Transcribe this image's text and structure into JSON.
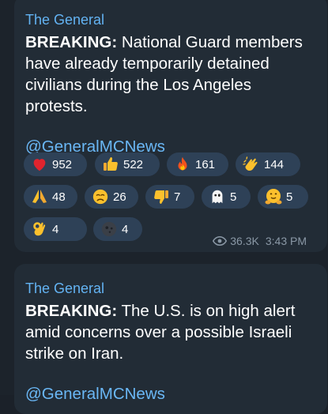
{
  "messages": [
    {
      "sender": "The General",
      "text_bold": "BREAKING:",
      "text_rest": " National Guard members have already temporarily detained civilians during the Los Angeles protests.",
      "link": "@GeneralMCNews",
      "reactions": [
        {
          "icon": "heart-icon",
          "count": "952"
        },
        {
          "icon": "thumbs-up-icon",
          "count": "522"
        },
        {
          "icon": "fire-icon",
          "count": "161"
        },
        {
          "icon": "clapping-hands-icon",
          "count": "144"
        },
        {
          "icon": "praying-hands-icon",
          "count": "48"
        },
        {
          "icon": "sad-face-icon",
          "count": "26"
        },
        {
          "icon": "thumbs-down-icon",
          "count": "7"
        },
        {
          "icon": "ghost-icon",
          "count": "5"
        },
        {
          "icon": "hugging-face-icon",
          "count": "5"
        },
        {
          "icon": "ok-hand-icon",
          "count": "4"
        },
        {
          "icon": "new-moon-face-icon",
          "count": "4"
        }
      ],
      "views": "36.3K",
      "time": "3:43 PM"
    },
    {
      "sender": "The General",
      "text_bold": "BREAKING:",
      "text_rest": " The U.S. is on high alert amid concerns over a possible Israeli strike on Iran.",
      "link": "@GeneralMCNews"
    }
  ],
  "colors": {
    "background": "#1c232b",
    "bubble": "#222c36",
    "sender": "#63b3f3",
    "link": "#6ab7f5",
    "reaction_pill": "#2e4157",
    "meta": "#8a98a6"
  }
}
